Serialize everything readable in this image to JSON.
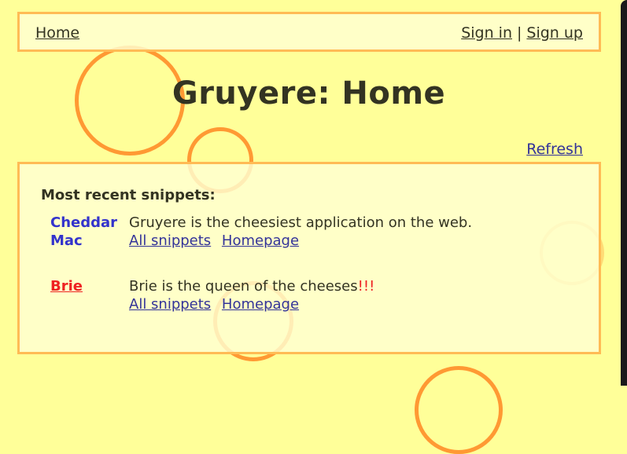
{
  "menu": {
    "home": "Home",
    "sign_in": "Sign in",
    "separator": "|",
    "sign_up": "Sign up"
  },
  "page": {
    "title": "Gruyere: Home",
    "refresh": "Refresh"
  },
  "snippets_section": {
    "title": "Most recent snippets:",
    "items": [
      {
        "author_line1": "Cheddar",
        "author_line2": "Mac",
        "text": "Gruyere is the cheesiest application on the web.",
        "emphasis": "",
        "link_all": "All snippets",
        "link_home": "Homepage"
      },
      {
        "author_line1": "Brie",
        "text": "Brie is the queen of the cheeses",
        "emphasis": "!!!",
        "link_all": "All snippets",
        "link_home": "Homepage"
      }
    ]
  },
  "colors": {
    "background": "#ffff99",
    "panel_border": "#ffbb55",
    "bubble": "#ff9933",
    "link": "#333399",
    "author_blue": "#3333cc",
    "author_red": "#ee2222"
  }
}
